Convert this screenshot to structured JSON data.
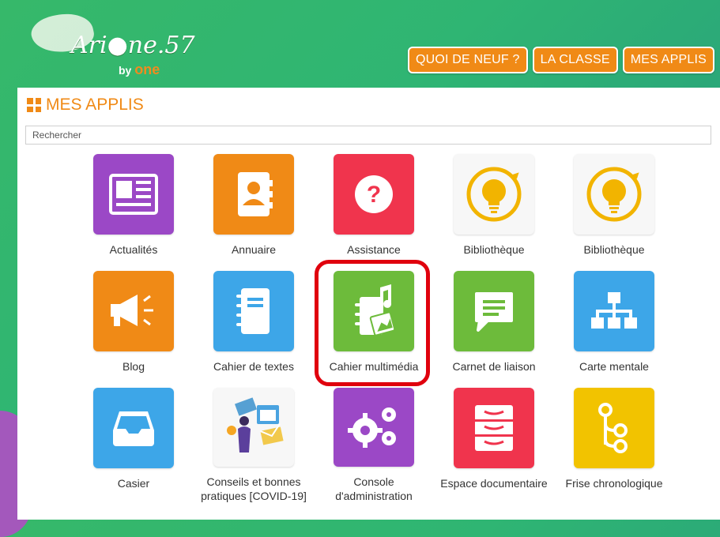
{
  "brand": {
    "logo_text": "Ari●ne.57",
    "logo_sub_prefix": "by",
    "logo_sub_brand": "one"
  },
  "nav": [
    {
      "label": "QUOI DE NEUF ?"
    },
    {
      "label": "LA CLASSE"
    },
    {
      "label": "MES APPLIS"
    }
  ],
  "panel": {
    "title": "MES APPLIS"
  },
  "search": {
    "placeholder": "Rechercher",
    "value": ""
  },
  "apps": [
    {
      "label": "Actualités",
      "icon": "newspaper-icon",
      "color": "#9b48c6"
    },
    {
      "label": "Annuaire",
      "icon": "contact-book-icon",
      "color": "#f08a16"
    },
    {
      "label": "Assistance",
      "icon": "question-icon",
      "color": "#f0344d"
    },
    {
      "label": "Bibliothèque",
      "icon": "lightbulb-icon",
      "color": "#f7f7f7"
    },
    {
      "label": "Bibliothèque",
      "icon": "lightbulb-icon",
      "color": "#f7f7f7"
    },
    {
      "label": "Blog",
      "icon": "megaphone-icon",
      "color": "#f08a16"
    },
    {
      "label": "Cahier de textes",
      "icon": "notebook-icon",
      "color": "#3da6e8"
    },
    {
      "label": "Cahier multimédia",
      "icon": "multimedia-notebook-icon",
      "color": "#6dbb3b"
    },
    {
      "label": "Carnet de liaison",
      "icon": "chat-bubble-icon",
      "color": "#6dbb3b"
    },
    {
      "label": "Carte mentale",
      "icon": "hierarchy-icon",
      "color": "#3da6e8"
    },
    {
      "label": "Casier",
      "icon": "inbox-tray-icon",
      "color": "#3da6e8"
    },
    {
      "label": "Conseils et bonnes pratiques [COVID-19]",
      "icon": "illustration-icon",
      "color": "#f7f7f7"
    },
    {
      "label": "Console d'administration",
      "icon": "gears-icon",
      "color": "#9b48c6"
    },
    {
      "label": "Espace documentaire",
      "icon": "drawers-icon",
      "color": "#f0344d"
    },
    {
      "label": "Frise chronologique",
      "icon": "timeline-icon",
      "color": "#f2c300"
    }
  ]
}
